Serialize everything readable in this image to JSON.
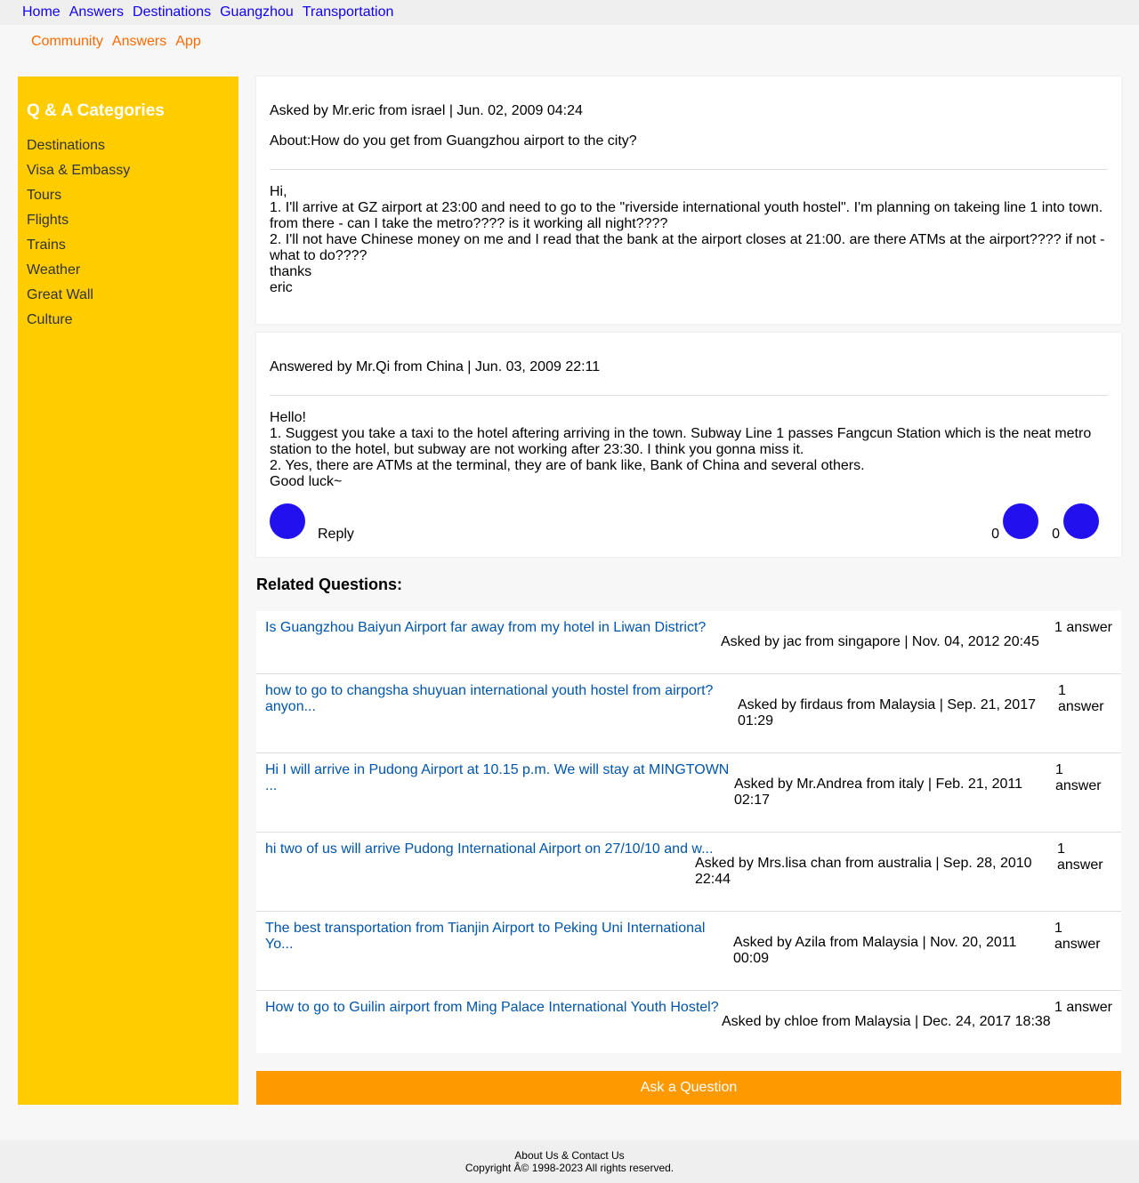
{
  "topnav": {
    "items": [
      "Home",
      "Answers",
      "Destinations",
      "Guangzhou",
      "Transportation"
    ]
  },
  "subnav": {
    "items": [
      "Community",
      "Answers",
      "App"
    ]
  },
  "sidebar": {
    "title": "Q & A Categories",
    "items": [
      "Destinations",
      "Visa & Embassy",
      "Tours",
      "Flights",
      "Trains",
      "Weather",
      "Great Wall",
      "Culture"
    ]
  },
  "question": {
    "meta": "Asked by Mr.eric from israel | Jun. 02, 2009 04:24",
    "about": "About:How do you get from Guangzhou airport to the city?",
    "body": "Hi,\n1. I'll arrive at GZ airport at 23:00 and need to go to the \"riverside international youth hostel\". I'm planning on takeing line 1 into town. from there - can I take the metro???? is it working all night????\n2. I'll not have Chinese money on me and I read that the bank at the airport closes at 21:00. are there ATMs at the airport???? if not - what to do????\nthanks\neric"
  },
  "answer": {
    "meta": "Answered by Mr.Qi from China | Jun. 03, 2009 22:11",
    "body": "Hello!\n1. Suggest you take a taxi to the hotel aftering arriving in the town. Subway Line 1 passes Fangcun Station which is the neat metro station to the hotel, but subway are not working after 23:30. I think you gonna miss it.\n2. Yes, there are ATMs at the terminal, they are of bank like, Bank of China and several others.\nGood luck~",
    "reply_label": "Reply",
    "like_count": "0",
    "dislike_count": "0"
  },
  "related": {
    "title": "Related Questions:",
    "items": [
      {
        "question": "Is Guangzhou Baiyun Airport far away from my hotel in Liwan District?",
        "meta": "Asked by jac from singapore | Nov. 04, 2012 20:45",
        "count": "1 answer"
      },
      {
        "question": "how to go to changsha shuyuan international youth hostel from airport? anyon...",
        "meta": "Asked by firdaus from Malaysia | Sep. 21, 2017 01:29",
        "count": "1 answer"
      },
      {
        "question": "Hi I will arrive in Pudong Airport at 10.15 p.m. We will stay at MINGTOWN ...",
        "meta": "Asked by Mr.Andrea from italy | Feb. 21, 2011 02:17",
        "count": "1 answer"
      },
      {
        "question": "hi two of us will arrive Pudong International Airport on 27/10/10 and w...",
        "meta": "Asked by Mrs.lisa chan from australia | Sep. 28, 2010 22:44",
        "count": "1 answer"
      },
      {
        "question": "The best transportation from Tianjin Airport to Peking Uni International Yo...",
        "meta": "Asked by Azila from Malaysia | Nov. 20, 2011 00:09",
        "count": "1 answer"
      },
      {
        "question": "How to go to Guilin airport from Ming Palace International Youth Hostel?",
        "meta": "Asked by chloe from Malaysia | Dec. 24, 2017 18:38",
        "count": "1 answer"
      }
    ]
  },
  "ask_button": "Ask a Question",
  "footer": {
    "links": "About Us & Contact Us",
    "copyright": "Copyright Â© 1998-2023 All rights reserved."
  },
  "colors": {
    "sidebar_bg": "#ffcc00",
    "ask_button_bg": "#ff9900",
    "link_blue": "#1100ee",
    "related_link": "#0055aa",
    "subnav_orange": "#ff6a00",
    "circle_blue": "#2211ee"
  }
}
